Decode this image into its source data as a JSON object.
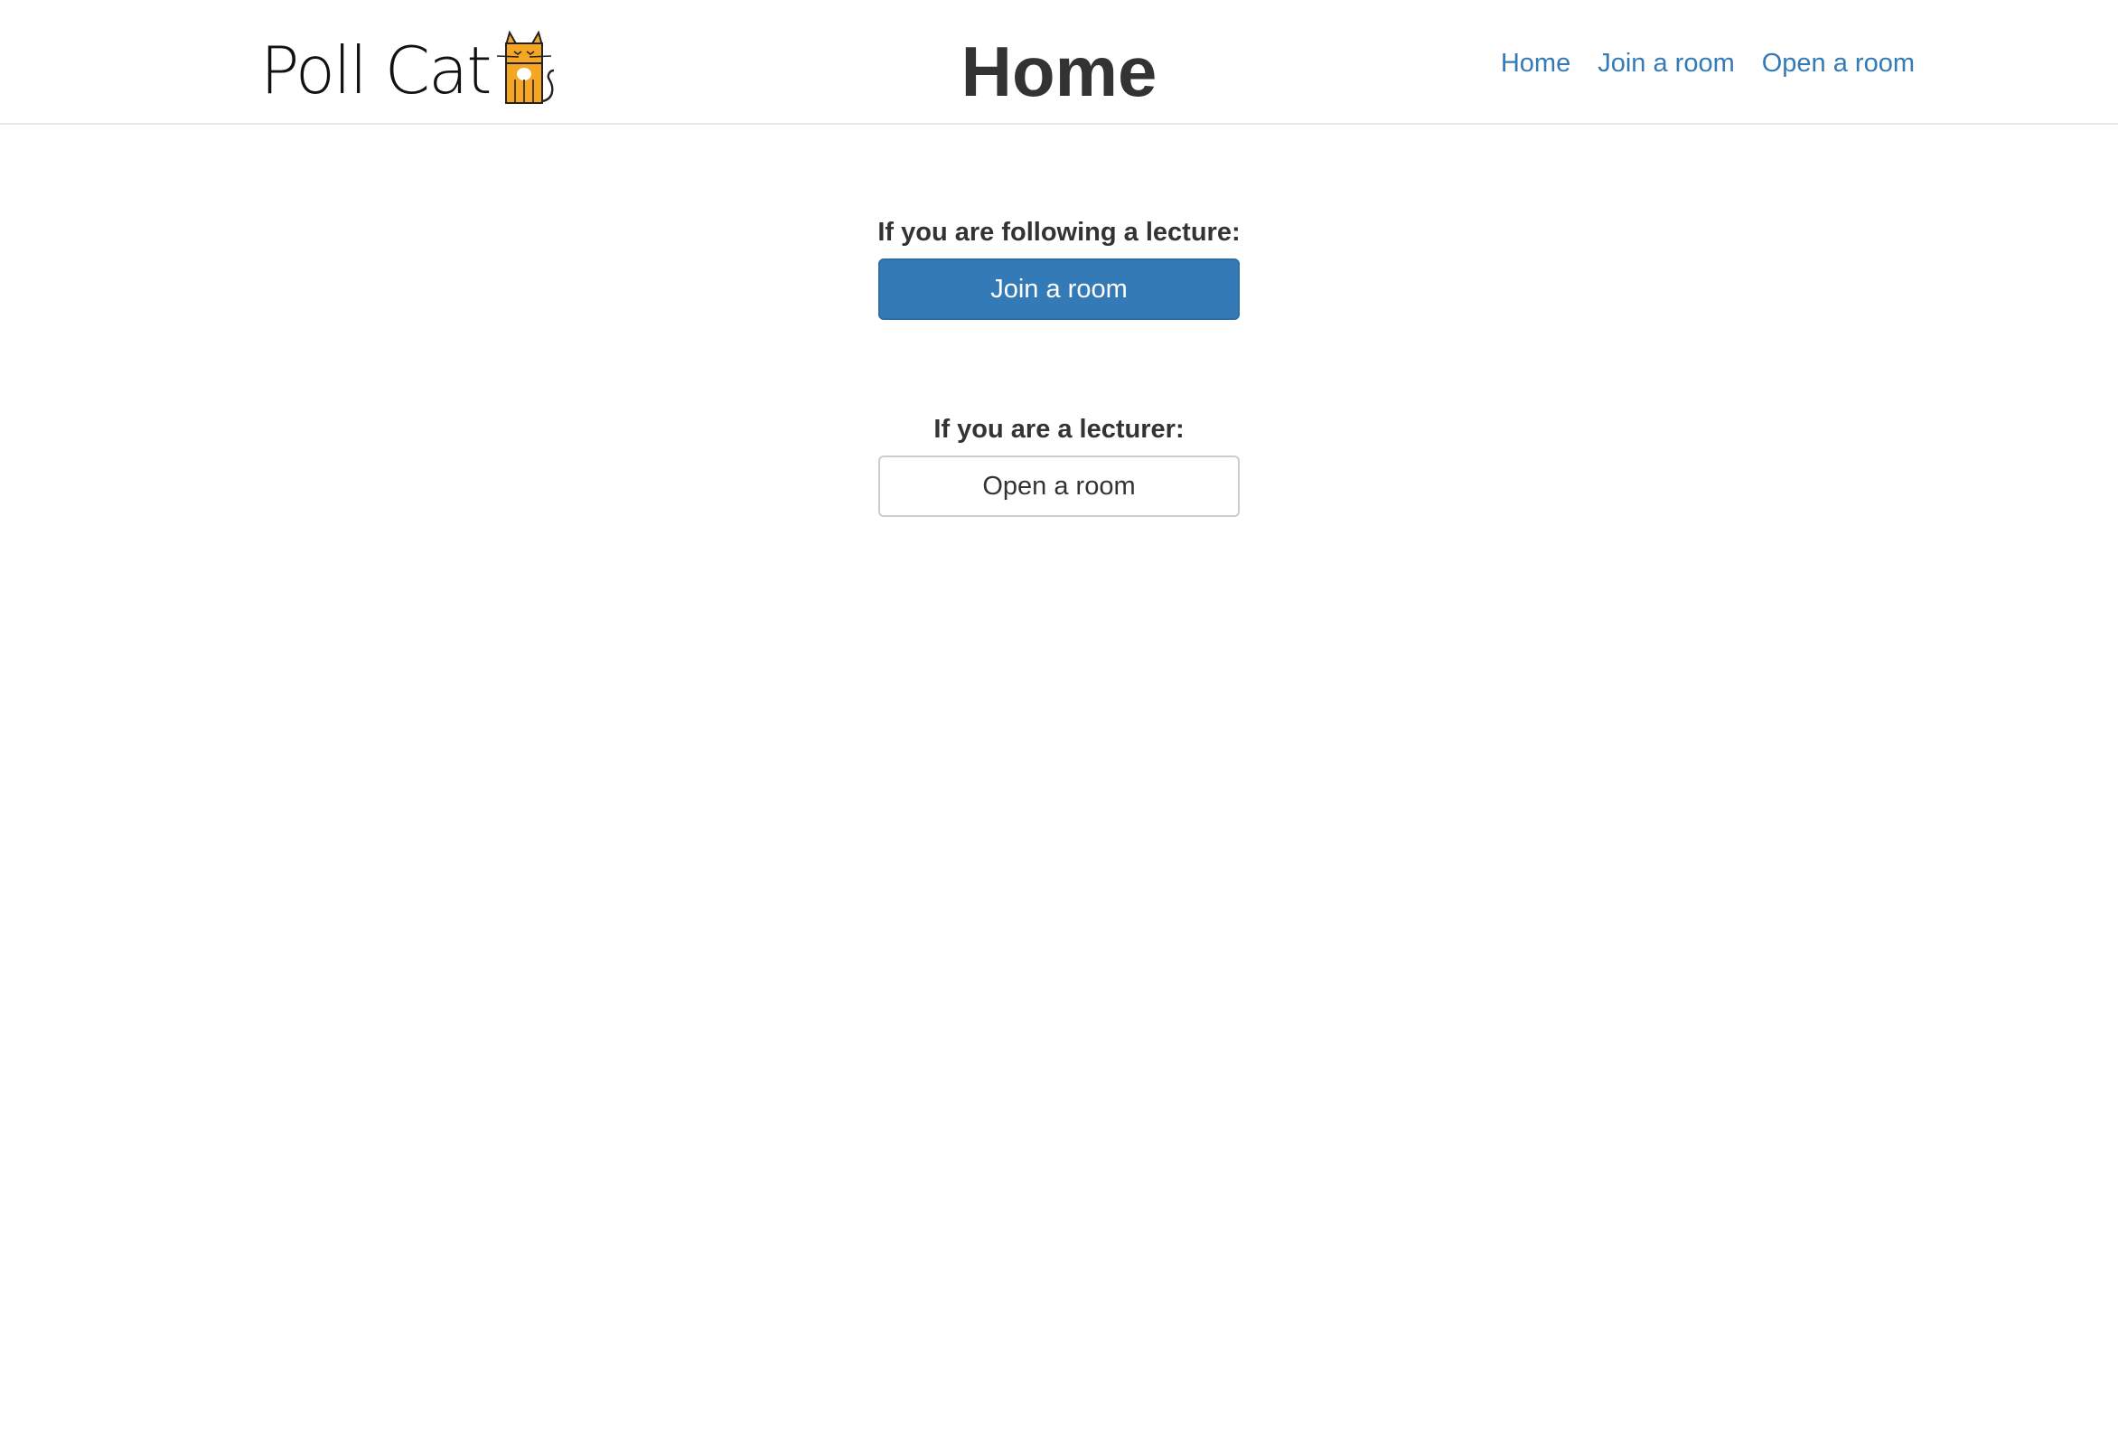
{
  "navbar": {
    "brand_text": "Poll Cat",
    "brand_logo_icon": "cat-icon",
    "brand_logo_color": "#f5a623",
    "title": "Home",
    "links": [
      {
        "label": "Home"
      },
      {
        "label": "Join a room"
      },
      {
        "label": "Open a room"
      }
    ]
  },
  "main": {
    "student": {
      "label": "If you are following a lecture:",
      "button_label": "Join a room"
    },
    "lecturer": {
      "label": "If you are a lecturer:",
      "button_label": "Open a room"
    }
  },
  "colors": {
    "link": "#337ab7",
    "primary": "#337ab7",
    "text": "#333333",
    "border": "#e7e7e7"
  }
}
